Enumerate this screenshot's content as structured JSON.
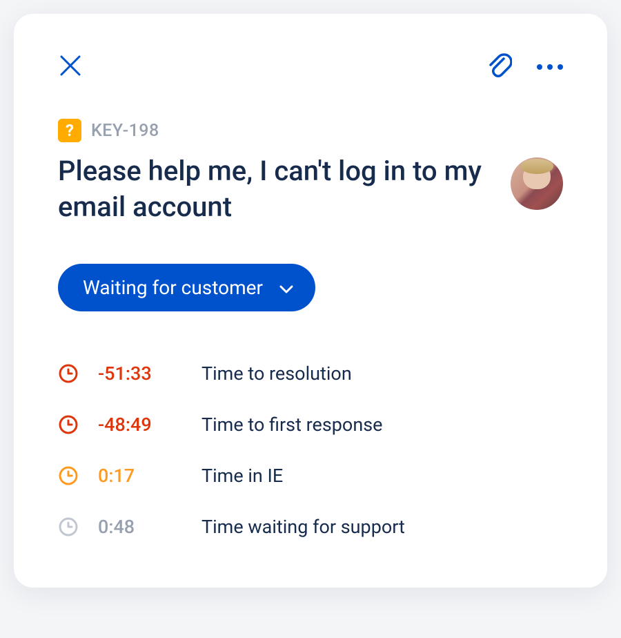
{
  "issue": {
    "key": "KEY-198",
    "title": "Please help me, I can't log in to my email account",
    "status_label": "Waiting for customer"
  },
  "sla": [
    {
      "time": "-51:33",
      "label": "Time to resolution",
      "state": "red"
    },
    {
      "time": "-48:49",
      "label": "Time to first response",
      "state": "red"
    },
    {
      "time": "0:17",
      "label": "Time in IE",
      "state": "orange"
    },
    {
      "time": "0:48",
      "label": "Time waiting for support",
      "state": "grey"
    }
  ],
  "colors": {
    "primary": "#0052cc",
    "danger": "#de350b",
    "warning": "#ff991f",
    "muted": "#97a0af",
    "text": "#172b4d"
  }
}
